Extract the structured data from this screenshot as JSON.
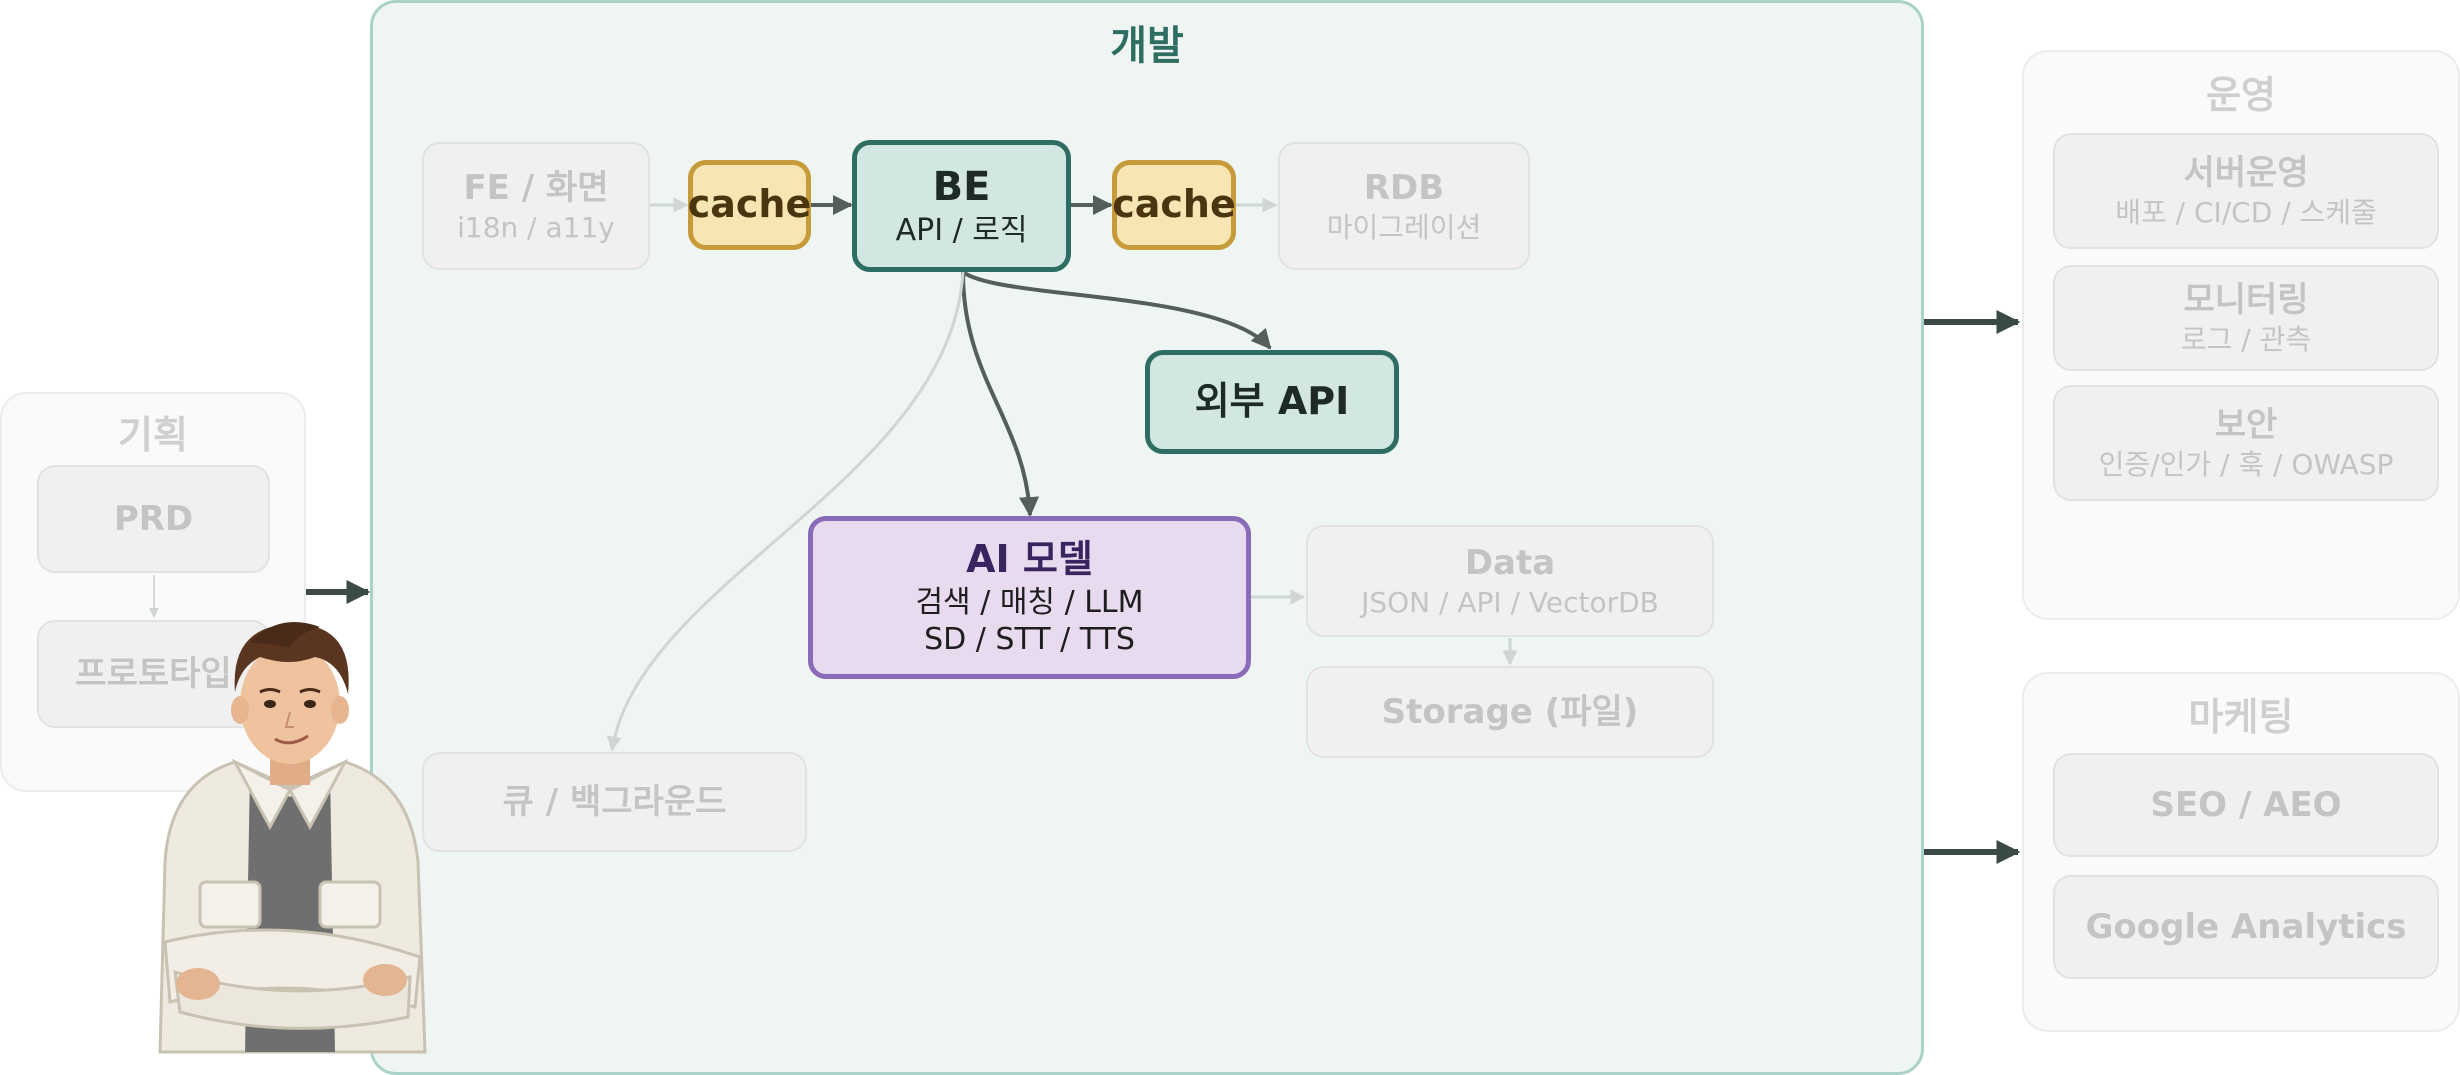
{
  "groups": {
    "planning": {
      "title": "기획",
      "prd": "PRD",
      "prototype": "프로토타입"
    },
    "dev": {
      "title": "개발",
      "fe": {
        "title": "FE / 화면",
        "sub": "i18n / a11y"
      },
      "cache_left": "cache",
      "be": {
        "title": "BE",
        "sub": "API / 로직"
      },
      "cache_right": "cache",
      "rdb": {
        "title": "RDB",
        "sub": "마이그레이션"
      },
      "external_api": "외부 API",
      "ai": {
        "title": "AI 모델",
        "sub1": "검색 / 매칭 / LLM",
        "sub2": "SD / STT / TTS"
      },
      "data": {
        "title": "Data",
        "sub": "JSON / API / VectorDB"
      },
      "storage": "Storage (파일)",
      "queue": "큐 / 백그라운드"
    },
    "ops": {
      "title": "운영",
      "server": {
        "title": "서버운영",
        "sub": "배포 / CI/CD / 스케줄"
      },
      "monitoring": {
        "title": "모니터링",
        "sub": "로그 / 관측"
      },
      "security": {
        "title": "보안",
        "sub": "인증/인가 / 훅 / OWASP"
      }
    },
    "marketing": {
      "title": "마케팅",
      "seo": "SEO / AEO",
      "ga": "Google Analytics"
    }
  },
  "colors": {
    "dev_border": "#a9d3c8",
    "be_border": "#2e6d62",
    "cache_fill": "#f8e5b4",
    "ai_border": "#8a6bb8",
    "arrow_dark": "#555e5c",
    "faded": "#c4c4c4"
  },
  "illustration": "smiling-young-man-cartoon"
}
